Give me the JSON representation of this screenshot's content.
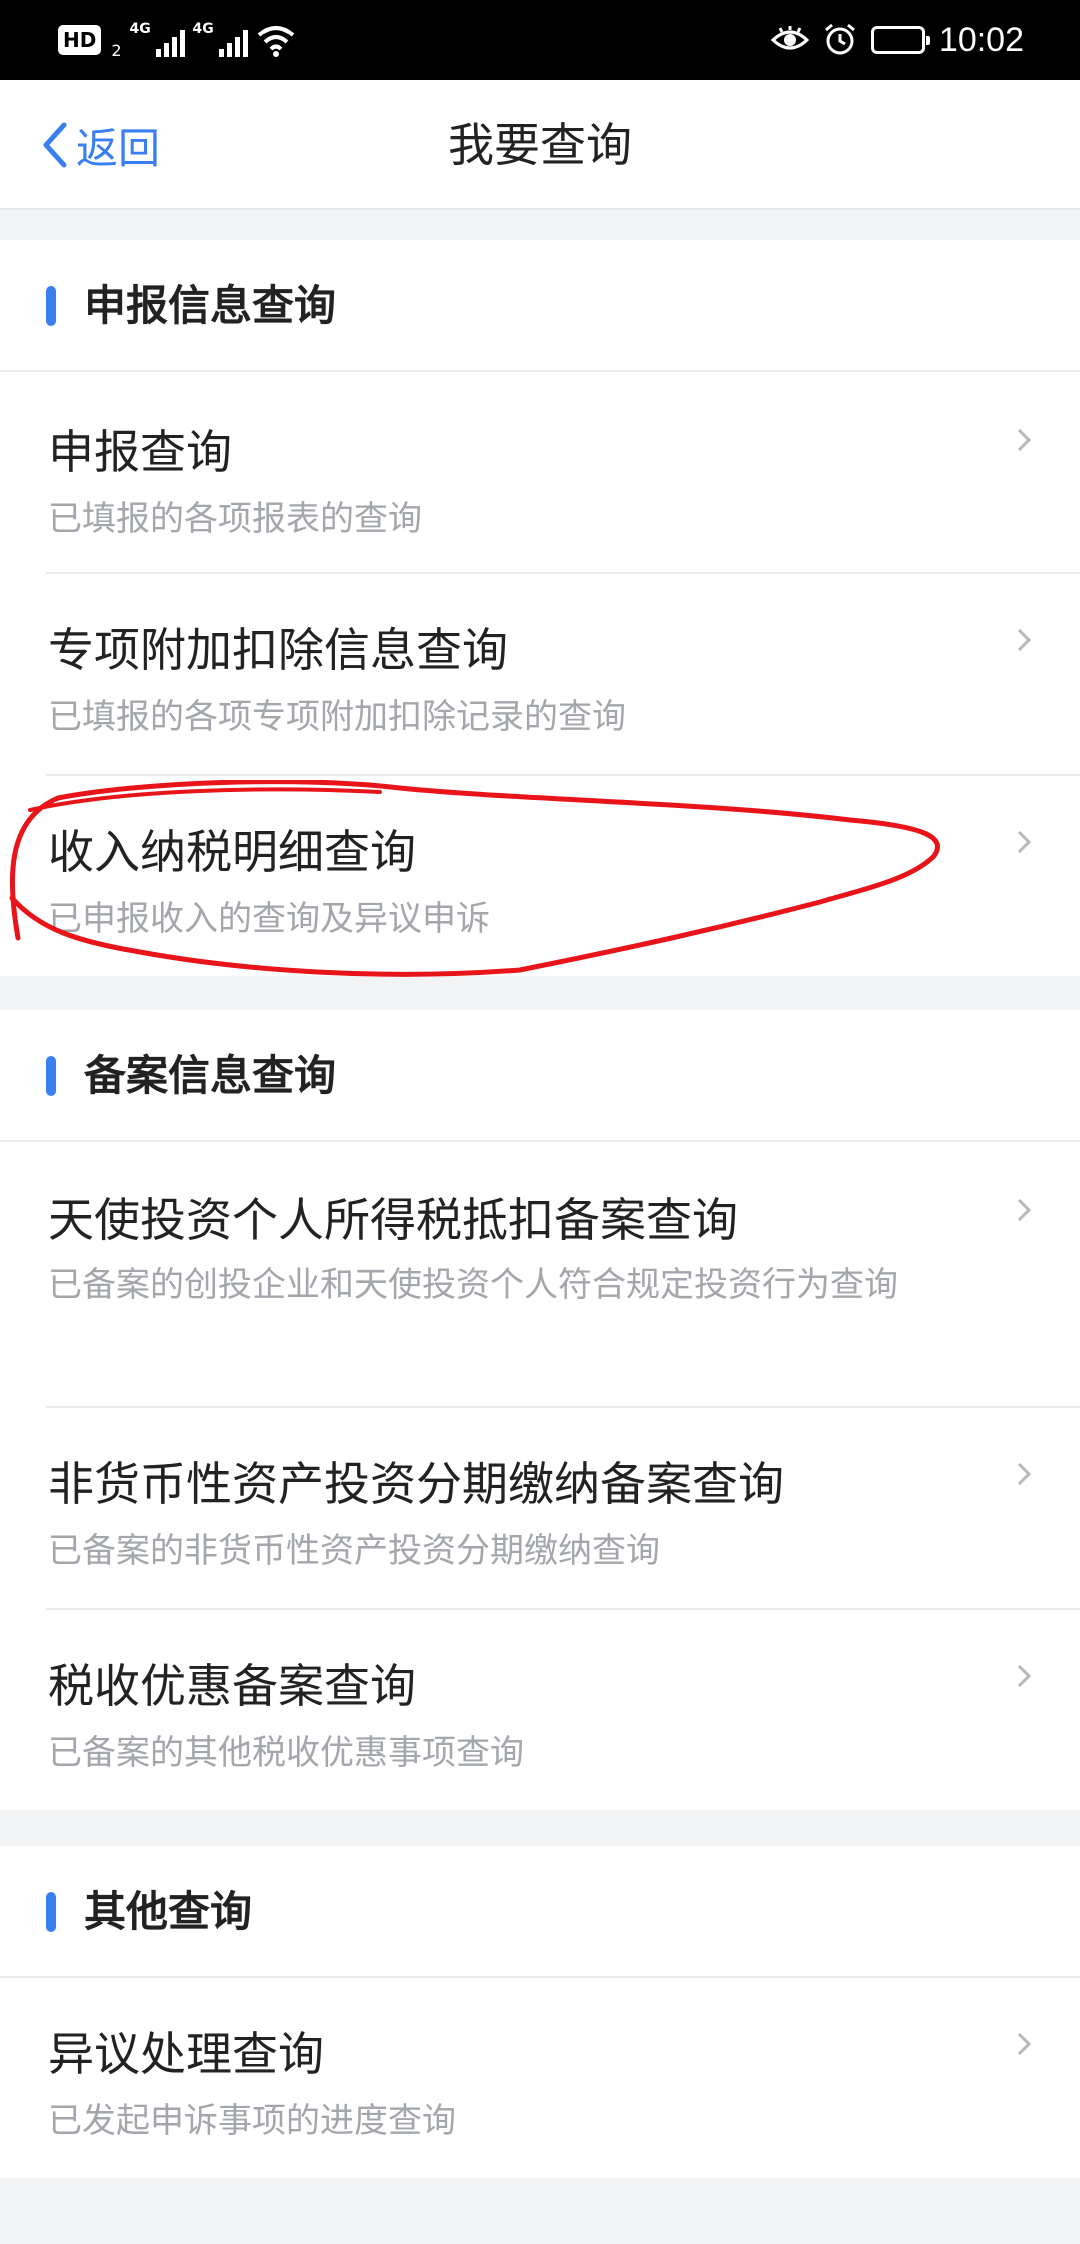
{
  "status_bar": {
    "hd_label": "HD",
    "hd_sub": "2",
    "sim1_label": "4G",
    "sim2_label": "4G",
    "time": "10:02"
  },
  "header": {
    "back_label": "返回",
    "title": "我要查询"
  },
  "sections": [
    {
      "title": "申报信息查询",
      "items": [
        {
          "title": "申报查询",
          "subtitle": "已填报的各项报表的查询"
        },
        {
          "title": "专项附加扣除信息查询",
          "subtitle": "已填报的各项专项附加扣除记录的查询"
        },
        {
          "title": "收入纳税明细查询",
          "subtitle": "已申报收入的查询及异议申诉"
        }
      ]
    },
    {
      "title": "备案信息查询",
      "items": [
        {
          "title": "天使投资个人所得税抵扣备案查询",
          "subtitle": "已备案的创投企业和天使投资个人符合规定投资行为查询"
        },
        {
          "title": "非货币性资产投资分期缴纳备案查询",
          "subtitle": "已备案的非货币性资产投资分期缴纳查询"
        },
        {
          "title": "税收优惠备案查询",
          "subtitle": "已备案的其他税收优惠事项查询"
        }
      ]
    },
    {
      "title": "其他查询",
      "items": [
        {
          "title": "异议处理查询",
          "subtitle": "已发起申诉事项的进度查询"
        }
      ]
    }
  ],
  "colors": {
    "accent": "#3a7ff0",
    "annotation": "#e8141a",
    "subtitle": "#a3a6ab",
    "background": "#f2f3f5"
  }
}
